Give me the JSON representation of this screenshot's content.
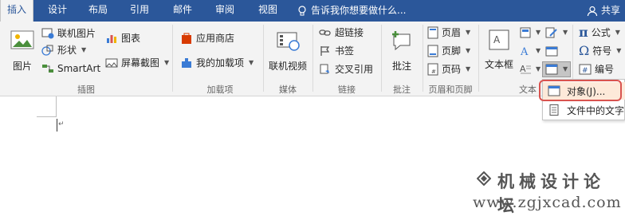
{
  "tabs": [
    {
      "label": "插入"
    },
    {
      "label": "设计"
    },
    {
      "label": "布局"
    },
    {
      "label": "引用"
    },
    {
      "label": "邮件"
    },
    {
      "label": "审阅"
    },
    {
      "label": "视图"
    }
  ],
  "tell_me": "告诉我你想要做什么...",
  "share": "共享",
  "illustrations": {
    "picture": "图片",
    "online_picture": "联机图片",
    "shapes": "形状",
    "smartart": "SmartArt",
    "chart": "图表",
    "screenshot": "屏幕截图",
    "group_label": "插图"
  },
  "addins": {
    "store": "应用商店",
    "my_addins": "我的加载项",
    "group_label": "加载项"
  },
  "media": {
    "online_video": "联机视频",
    "group_label": "媒体"
  },
  "links": {
    "hyperlink": "超链接",
    "bookmark": "书签",
    "cross_ref": "交叉引用",
    "group_label": "链接"
  },
  "comments": {
    "comment": "批注",
    "group_label": "批注"
  },
  "header_footer": {
    "header": "页眉",
    "footer": "页脚",
    "page_number": "页码",
    "group_label": "页眉和页脚"
  },
  "text": {
    "textbox": "文本框",
    "group_label": "文本"
  },
  "symbols": {
    "equation": "公式",
    "symbol": "符号",
    "numbering": "编号"
  },
  "object_menu": {
    "object": "对象(J)...",
    "text_from_file": "文件中的文字"
  },
  "watermark": {
    "line1": "机械设计论坛",
    "line2": "www.zgjxcad.com"
  },
  "colors": {
    "accent": "#2b579a",
    "highlight_ring": "#d9534f"
  }
}
